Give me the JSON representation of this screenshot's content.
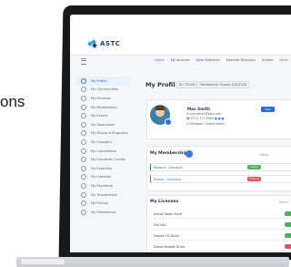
{
  "background_text": "ons",
  "app": {
    "logo_text": "ASTC",
    "colors": {
      "primary": "#2d6fd6",
      "success": "#4cae5e",
      "danger": "#e05263",
      "logo": "#1fa8c9"
    }
  },
  "nav": {
    "items": [
      "Home",
      "My Account",
      "Data Statistics",
      "Member Directory",
      "Events",
      "Onlin"
    ],
    "active_index": 0
  },
  "sidebar": {
    "items": [
      {
        "label": "My Profile",
        "active": true
      },
      {
        "label": "My Communities"
      },
      {
        "label": "My Finances"
      },
      {
        "label": "My Membership"
      },
      {
        "label": "My Events"
      },
      {
        "label": "My Downloads"
      },
      {
        "label": "My Discount Programs"
      },
      {
        "label": "My Chapters"
      },
      {
        "label": "My Committees"
      },
      {
        "label": "My Education Credits"
      },
      {
        "label": "My Expertise"
      },
      {
        "label": "My Interests"
      },
      {
        "label": "My Payments"
      },
      {
        "label": "My Transactions"
      },
      {
        "label": "My Pricing"
      },
      {
        "label": "My Preferences"
      }
    ]
  },
  "profile": {
    "title": "My Profile",
    "chips": [
      "ID: 734594",
      "Membership: Expires 4/30/2026"
    ],
    "name": "Max Smith",
    "email": "max.smith@astc.com",
    "phone": "(571) 277-9083",
    "location": "Delaware, United States",
    "edit_label": "Edit"
  },
  "memberships": {
    "title": "My Memberships",
    "status_header": "Status",
    "rows": [
      {
        "name": "National - Individual",
        "status": "Active",
        "status_color": "#4cae5e"
      },
      {
        "name": "Kansas - Individual",
        "status": "Expired",
        "status_color": "#e05263"
      }
    ]
  },
  "licenses": {
    "title": "My Licenses",
    "status_header": "Status",
    "rows": [
      {
        "name": "Annual Water Adult",
        "status_color": "#4cae5e"
      },
      {
        "name": "Dist N&C",
        "status_color": "#4cae5e"
      },
      {
        "name": "Dakota Full Driver",
        "status_color": "#4cae5e"
      },
      {
        "name": "Dakota Budget Driver",
        "status_color": "#e05263"
      }
    ]
  }
}
